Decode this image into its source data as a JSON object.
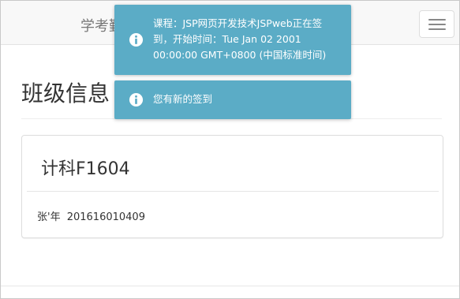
{
  "navbar": {
    "brand": "学考勤系统",
    "menu_icon": "hamburger-menu-icon"
  },
  "page": {
    "title": "班级信息"
  },
  "class_card": {
    "name": "计科F1604",
    "student": {
      "name": "张'年",
      "id": "201616010409"
    }
  },
  "notifications": [
    {
      "icon": "info-icon",
      "message": "课程：JSP网页开发技术JSPweb正在签到，开始时间：Tue Jan 02 2001 00:00:00 GMT+0800 (中国标准时间)"
    },
    {
      "icon": "info-icon",
      "message": "您有新的签到"
    }
  ],
  "colors": {
    "toast_bg": "#5bacc6",
    "navbar_bg": "#f8f8f8"
  }
}
